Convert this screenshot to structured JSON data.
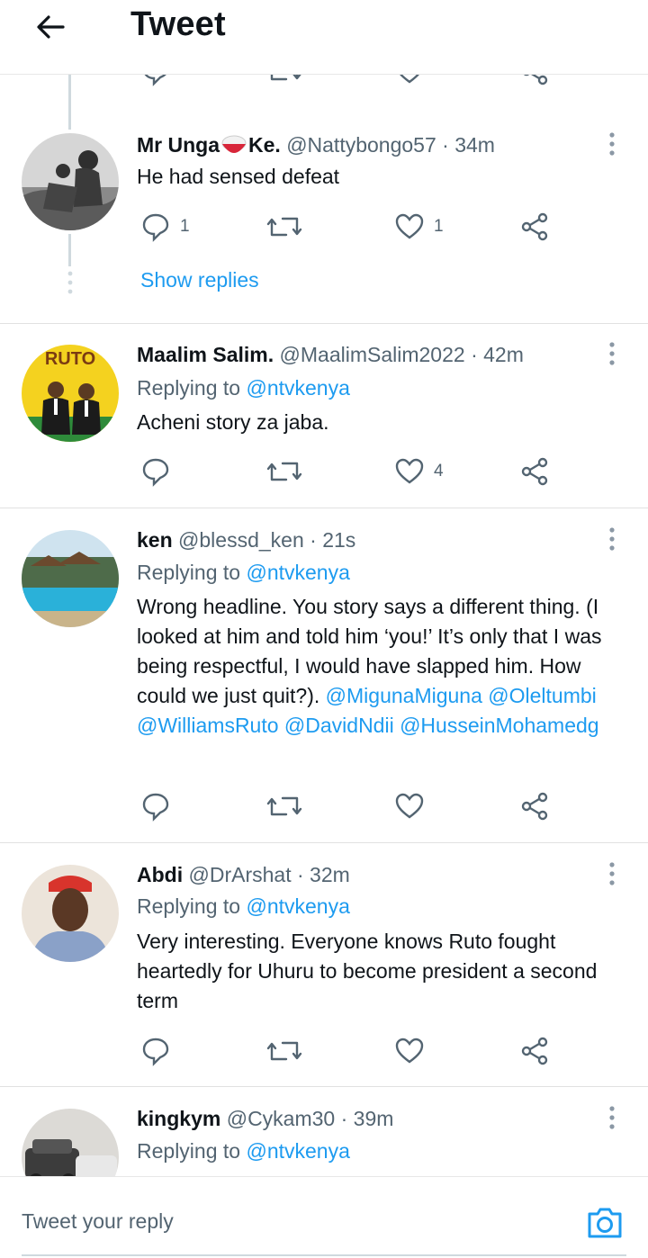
{
  "header": {
    "title": "Tweet"
  },
  "tweets": [
    {
      "name": "Mr Unga",
      "name_after": "Ke.",
      "handle": "@Nattybongo57",
      "time": "· 34m",
      "text": "He had sensed defeat",
      "replies": "1",
      "likes": "1",
      "show_replies": "Show replies"
    },
    {
      "name": "Maalim Salim.",
      "handle": "@MaalimSalim2022",
      "time": "· 42m",
      "replying_prefix": "Replying to",
      "replying_to": "@ntvkenya",
      "text": "Acheni story za jaba.",
      "likes": "4",
      "avatar_text": "RUTO"
    },
    {
      "name": "ken",
      "handle": "@blessd_ken",
      "time": "· 21s",
      "replying_prefix": "Replying to",
      "replying_to": "@ntvkenya",
      "text": "Wrong headline. You story says a different thing. (I looked at him and told him ‘you!’ It’s only that I was being respectful, I would have slapped him. How could we just quit?).",
      "mentions": "@MigunaMiguna @Oleltumbi @WilliamsRuto @DavidNdii @HusseinMohamedg"
    },
    {
      "name": "Abdi",
      "handle": "@DrArshat",
      "time": "· 32m",
      "replying_prefix": "Replying to",
      "replying_to": "@ntvkenya",
      "text": "Very interesting. Everyone knows Ruto fought heartedly for Uhuru to become president a second term"
    },
    {
      "name": "kingkym",
      "handle": "@Cykam30",
      "time": "· 39m",
      "replying_prefix": "Replying to",
      "replying_to": "@ntvkenya"
    }
  ],
  "reply_box": {
    "placeholder": "Tweet your reply"
  },
  "icons": {
    "back": "arrow-left-icon",
    "more": "vertical-dots-icon",
    "reply": "speech-bubble-icon",
    "retweet": "retweet-icon",
    "like": "heart-icon",
    "share": "share-icon",
    "camera": "camera-icon"
  },
  "colors": {
    "accent": "#1d9bf0",
    "secondary_text": "#536471",
    "icon_gray": "#536471"
  }
}
